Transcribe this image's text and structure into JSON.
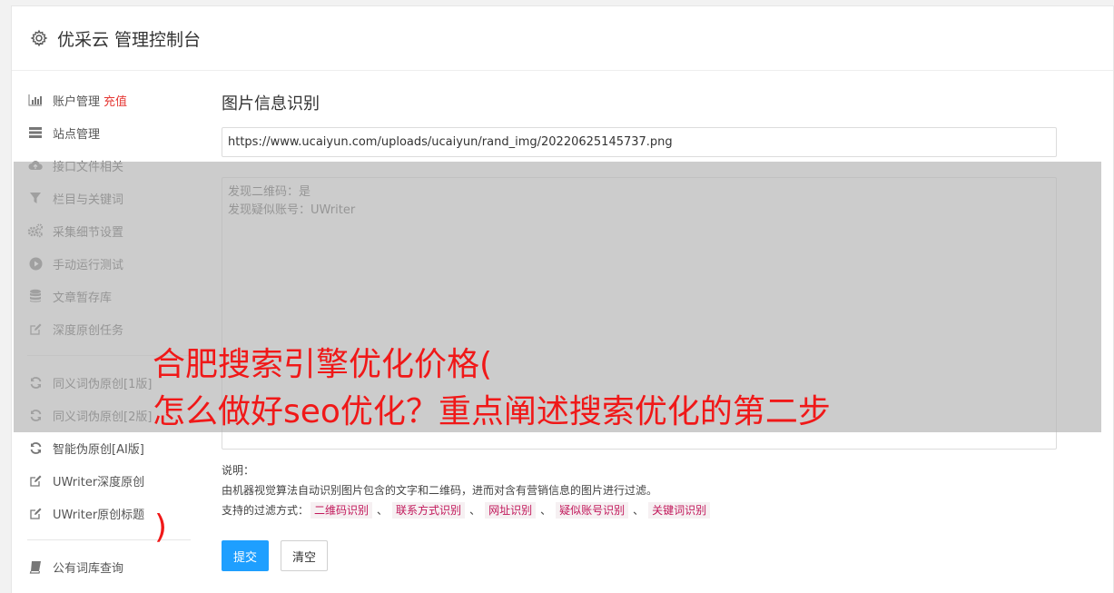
{
  "header": {
    "title": "优采云 管理控制台",
    "icon": "gear-icon"
  },
  "sidebar": {
    "items": [
      {
        "label": "账户管理",
        "badge": "充值",
        "icon": "bar-chart-icon"
      },
      {
        "label": "站点管理",
        "icon": "server-icon"
      },
      {
        "label": "接口文件相关",
        "icon": "cloud-upload-icon"
      },
      {
        "label": "栏目与关键词",
        "icon": "filter-icon"
      },
      {
        "label": "采集细节设置",
        "icon": "gears-icon"
      },
      {
        "label": "手动运行测试",
        "icon": "play-circle-icon"
      },
      {
        "label": "文章暂存库",
        "icon": "database-icon"
      },
      {
        "label": "深度原创任务",
        "icon": "edit-icon"
      }
    ],
    "items2": [
      {
        "label": "同义词伪原创[1版]",
        "icon": "refresh-icon"
      },
      {
        "label": "同义词伪原创[2版]",
        "icon": "refresh-icon"
      },
      {
        "label": "智能伪原创[AI版]",
        "icon": "refresh-icon"
      },
      {
        "label": "UWriter深度原创",
        "icon": "edit-icon"
      },
      {
        "label": "UWriter原创标题",
        "icon": "edit-icon"
      }
    ],
    "items3": [
      {
        "label": "公有词库查询",
        "icon": "book-icon"
      }
    ]
  },
  "main": {
    "heading": "图片信息识别",
    "url_value": "https://www.ucaiyun.com/uploads/ucaiyun/rand_img/20220625145737.png",
    "result_lines": [
      "发现二维码：是",
      "发现疑似账号：UWriter"
    ],
    "note_title": "说明：",
    "note_desc": "由机器视觉算法自动识别图片包含的文字和二维码，进而对含有营销信息的图片进行过滤。",
    "filter_label": "支持的过滤方式：",
    "filters": [
      "二维码识别",
      "联系方式识别",
      "网址识别",
      "疑似账号识别",
      "关键词识别"
    ],
    "separator": "、",
    "submit_label": "提交",
    "clear_label": "清空"
  },
  "overlay": {
    "line1": "合肥搜索引擎优化价格(",
    "line2": "怎么做好seo优化？重点阐述搜索优化的第二步",
    "line3": ")",
    "color": "#f01818"
  }
}
